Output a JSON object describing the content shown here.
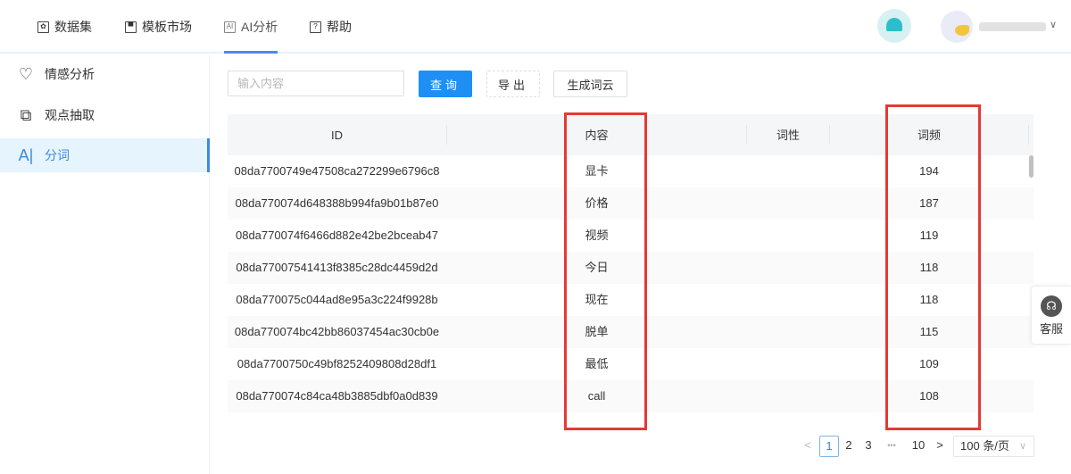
{
  "nav": [
    {
      "label": "数据集",
      "icon": "dataset-icon"
    },
    {
      "label": "模板市场",
      "icon": "template-icon"
    },
    {
      "label": "AI分析",
      "icon": "ai-icon",
      "active": true
    },
    {
      "label": "帮助",
      "icon": "help-icon"
    }
  ],
  "sidebar": [
    {
      "label": "情感分析",
      "icon": "heart-icon"
    },
    {
      "label": "观点抽取",
      "icon": "copy-icon"
    },
    {
      "label": "分词",
      "icon": "ai-text-icon",
      "active": true
    }
  ],
  "toolbar": {
    "search_placeholder": "输入内容",
    "query": "查询",
    "export": "导出",
    "wordcloud": "生成词云"
  },
  "table": {
    "columns": [
      "ID",
      "内容",
      "词性",
      "词频"
    ],
    "rows": [
      {
        "id": "08da7700749e47508ca272299e6796c8",
        "content": "显卡",
        "pos": "",
        "freq": "194"
      },
      {
        "id": "08da770074d648388b994fa9b01b87e0",
        "content": "价格",
        "pos": "",
        "freq": "187"
      },
      {
        "id": "08da770074f6466d882e42be2bceab47",
        "content": "视频",
        "pos": "",
        "freq": "119"
      },
      {
        "id": "08da77007541413f8385c28dc4459d2d",
        "content": "今日",
        "pos": "",
        "freq": "118"
      },
      {
        "id": "08da770075c044ad8e95a3c224f9928b",
        "content": "现在",
        "pos": "",
        "freq": "118"
      },
      {
        "id": "08da770074bc42bb86037454ac30cb0e",
        "content": "脱单",
        "pos": "",
        "freq": "115"
      },
      {
        "id": "08da7700750c49bf8252409808d28df1",
        "content": "最低",
        "pos": "",
        "freq": "109"
      },
      {
        "id": "08da770074c84ca48b3885dbf0a0d839",
        "content": "call",
        "pos": "",
        "freq": "108"
      }
    ]
  },
  "pagination": {
    "prev": "<",
    "pages": [
      "1",
      "2",
      "3"
    ],
    "ellipsis": "•••",
    "last": "10",
    "next": ">",
    "current": "1",
    "page_size": "100 条/页"
  },
  "service": {
    "label": "客服"
  },
  "colors": {
    "accent": "#1e90f5",
    "highlight": "#e53935"
  }
}
